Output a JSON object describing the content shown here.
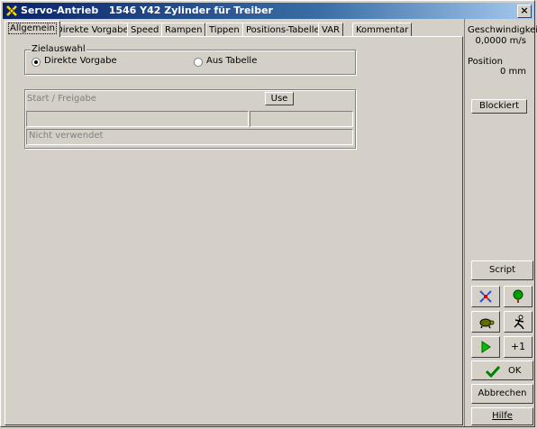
{
  "window": {
    "title": "Servo-Antrieb   1546 Y42 Zylinder für Treiber",
    "close_label": "×"
  },
  "tabs": [
    {
      "label": "Allgemein",
      "active": true
    },
    {
      "label": "Direkte Vorgabe"
    },
    {
      "label": "Speed"
    },
    {
      "label": "Rampen"
    },
    {
      "label": "Tippen"
    },
    {
      "label": "Positions-Tabelle"
    },
    {
      "label": "VAR"
    },
    {
      "label": "Kommentar"
    }
  ],
  "zielauswahl": {
    "legend": "Zielauswahl",
    "options": [
      {
        "label": "Direkte Vorgabe",
        "selected": true
      },
      {
        "label": "Aus Tabelle",
        "selected": false
      }
    ]
  },
  "start": {
    "label": "Start / Freigabe",
    "use_button": "Use",
    "field_a": "",
    "field_b": "",
    "status": "Nicht verwendet"
  },
  "side": {
    "speed_label": "Geschwindigkeit",
    "speed_value": "0,0000 m/s",
    "position_label": "Position",
    "position_value": "0 mm",
    "blocked_button": "Blockiert",
    "script_button": "Script",
    "plus_one_button": "+1",
    "ok_button": "OK",
    "cancel_button": "Abbrechen",
    "help_button": "Hilfe"
  },
  "icons": [
    "app-icon",
    "collapse-icon",
    "tree-icon",
    "turtle-icon",
    "runner-icon",
    "play-icon",
    "checkmark-icon"
  ],
  "colors": {
    "titlebar": "#0a246a",
    "play": "#00c000",
    "ok_check": "#008000"
  }
}
